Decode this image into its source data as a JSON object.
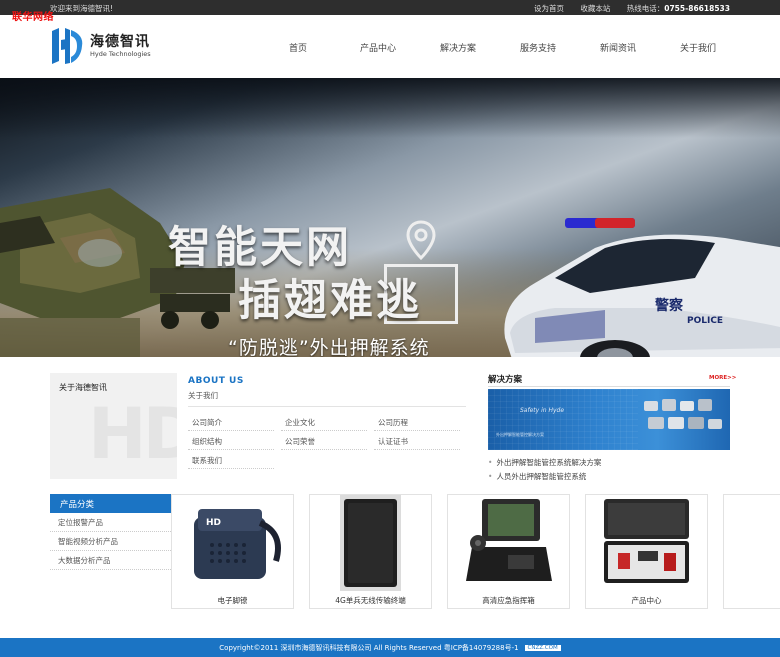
{
  "topbar": {
    "brand_tag": "联华网络",
    "welcome": "欢迎来到海德智讯!",
    "set_home": "设为首页",
    "bookmark": "收藏本站",
    "phone_label": "热线电话：",
    "phone": "0755-86618533"
  },
  "header": {
    "logo_cn": "海德智讯",
    "logo_en": "Hyde Technologies",
    "nav": [
      "首页",
      "产品中心",
      "解决方案",
      "服务支持",
      "新闻资讯",
      "关于我们"
    ]
  },
  "banner": {
    "line1": "智能天网",
    "line2": "插翅难逃",
    "line3": "“防脱逃”外出押解系统",
    "car_text": "POLICE",
    "car_text_cn": "警察",
    "slides": 3,
    "active_slide": 2
  },
  "about_box": {
    "title": "关于海德智讯",
    "watermark": "HD"
  },
  "categories": {
    "title": "产品分类",
    "items": [
      "定位报警产品",
      "智能视频分析产品",
      "大数据分析产品"
    ]
  },
  "about_us": {
    "title": "ABOUT US",
    "subtitle": "关于我们",
    "links": [
      "公司简介",
      "企业文化",
      "公司历程",
      "组织结构",
      "公司荣誉",
      "认证证书",
      "联系我们"
    ]
  },
  "solutions": {
    "title": "解决方案",
    "more": "MORE>>",
    "image_title": "Safety in Hyde",
    "image_text": "外出押解智能管控解决方案",
    "items": [
      "外出押解智能管控系统解决方案",
      "人员外出押解智能管控系统"
    ]
  },
  "products": [
    {
      "caption": "电子脚镣"
    },
    {
      "caption": "4G单兵无线传输终端"
    },
    {
      "caption": "高清应急指挥箱"
    },
    {
      "caption": "产品中心"
    }
  ],
  "footer": {
    "copyright": "Copyright©2011 深圳市海德智讯科技有限公司 All Rights Reserved 粤ICP备14079288号-1",
    "badge": "CNZZ.COM"
  },
  "colors": {
    "accent": "#1b74c4",
    "topbar": "#2e2e2e",
    "more_red": "#dd2222"
  }
}
